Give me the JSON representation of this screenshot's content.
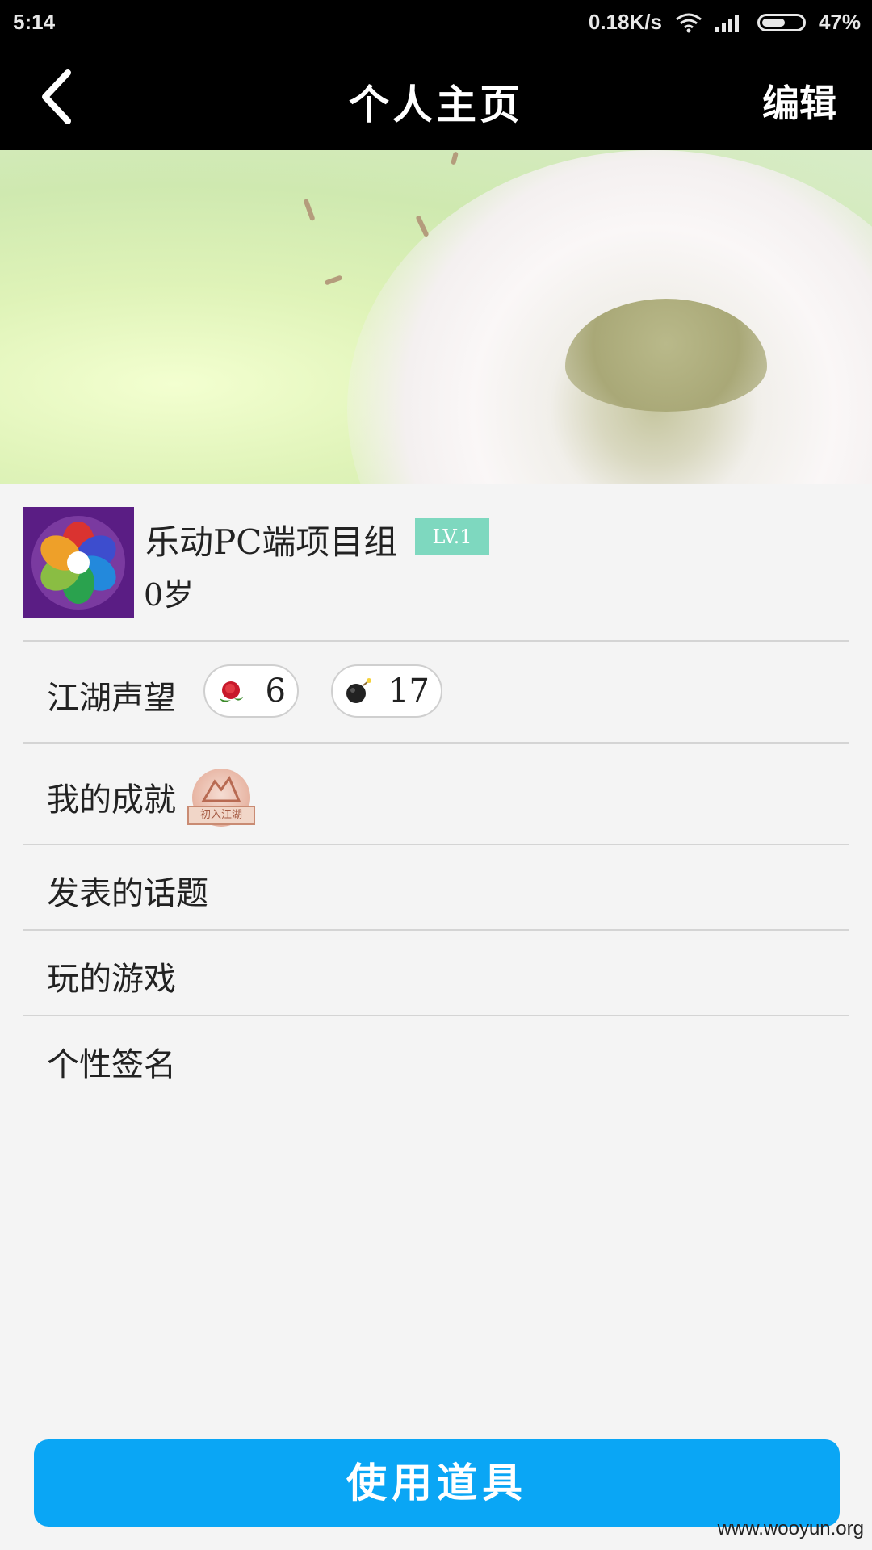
{
  "status_bar": {
    "time": "5:14",
    "net_speed": "0.18K/s",
    "battery": "47%",
    "icons": [
      "wifi-icon",
      "signal-icon",
      "battery-icon"
    ]
  },
  "header": {
    "title": "个人主页",
    "edit_label": "编辑",
    "back_icon": "chevron-left-icon"
  },
  "profile": {
    "name": "乐动PC端项目组",
    "level": "LV.1",
    "age": "0岁"
  },
  "rows": {
    "reputation": {
      "label": "江湖声望",
      "items": [
        {
          "icon": "rose-icon",
          "count": "6"
        },
        {
          "icon": "bomb-icon",
          "count": "17"
        }
      ]
    },
    "achievements": {
      "label": "我的成就",
      "badge_text": "初入江湖"
    },
    "topics": {
      "label": "发表的话题"
    },
    "games": {
      "label": "玩的游戏"
    },
    "signature": {
      "label": "个性签名"
    }
  },
  "footer": {
    "button_label": "使用道具",
    "watermark": "www.wooyun.org"
  },
  "colors": {
    "accent": "#0aa6f5",
    "level_badge": "#7ed8bf",
    "header_bg": "#000000"
  }
}
